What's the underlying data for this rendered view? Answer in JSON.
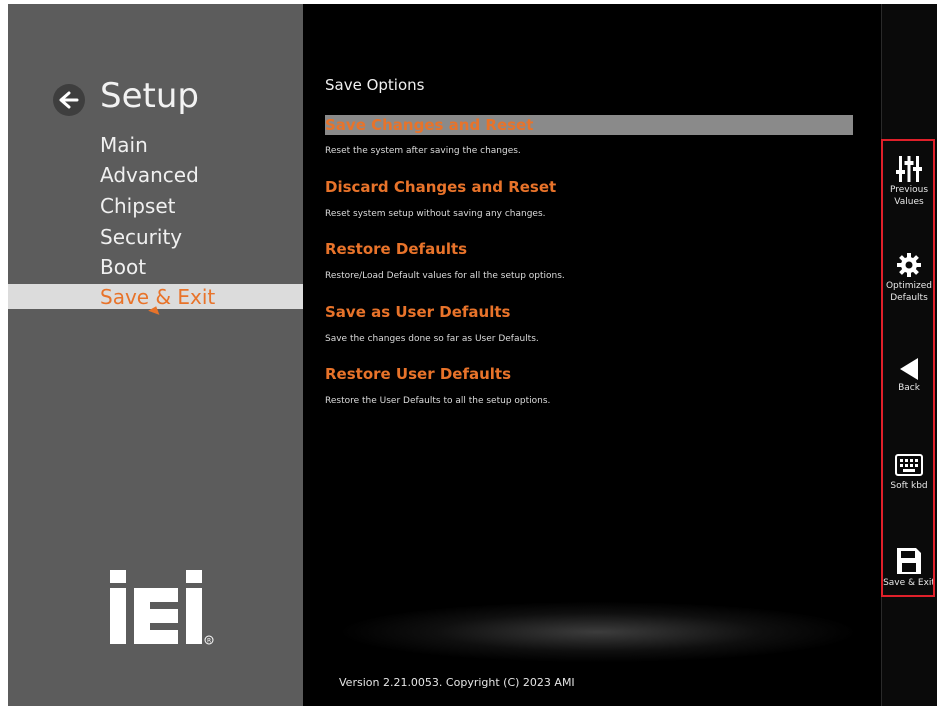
{
  "header": {
    "title": "Setup"
  },
  "menu": {
    "items": [
      {
        "label": "Main"
      },
      {
        "label": "Advanced"
      },
      {
        "label": "Chipset"
      },
      {
        "label": "Security"
      },
      {
        "label": "Boot"
      },
      {
        "label": "Save & Exit",
        "selected": true
      }
    ]
  },
  "main": {
    "section_title": "Save Options",
    "options": [
      {
        "label": "Save Changes and Reset",
        "description": "Reset the system after saving the changes.",
        "selected": true
      },
      {
        "label": "Discard Changes and Reset",
        "description": "Reset system setup without saving any changes."
      },
      {
        "label": "Restore Defaults",
        "description": "Restore/Load Default values for all the setup options."
      },
      {
        "label": "Save as User Defaults",
        "description": "Save the changes done so far as User Defaults."
      },
      {
        "label": "Restore User Defaults",
        "description": "Restore the User Defaults to all the setup options."
      }
    ]
  },
  "toolbar": {
    "items": [
      {
        "label_line1": "Previous",
        "label_line2": "Values",
        "icon": "sliders-icon"
      },
      {
        "label_line1": "Optimized",
        "label_line2": "Defaults",
        "icon": "gear-icon"
      },
      {
        "label_line1": "Back",
        "label_line2": "",
        "icon": "back-arrow-icon"
      },
      {
        "label_line1": "Soft kbd",
        "label_line2": "",
        "icon": "keyboard-icon"
      },
      {
        "label_line1": "Save & Exit",
        "label_line2": "",
        "icon": "floppy-icon"
      }
    ]
  },
  "footer": {
    "version": "Version 2.21.0053. Copyright (C) 2023 AMI"
  },
  "logo": {
    "text": "iEi"
  },
  "colors": {
    "accent": "#e8732a",
    "highlight_box": "#e0202a",
    "left_panel": "#5c5c5c",
    "background": "#000000"
  }
}
